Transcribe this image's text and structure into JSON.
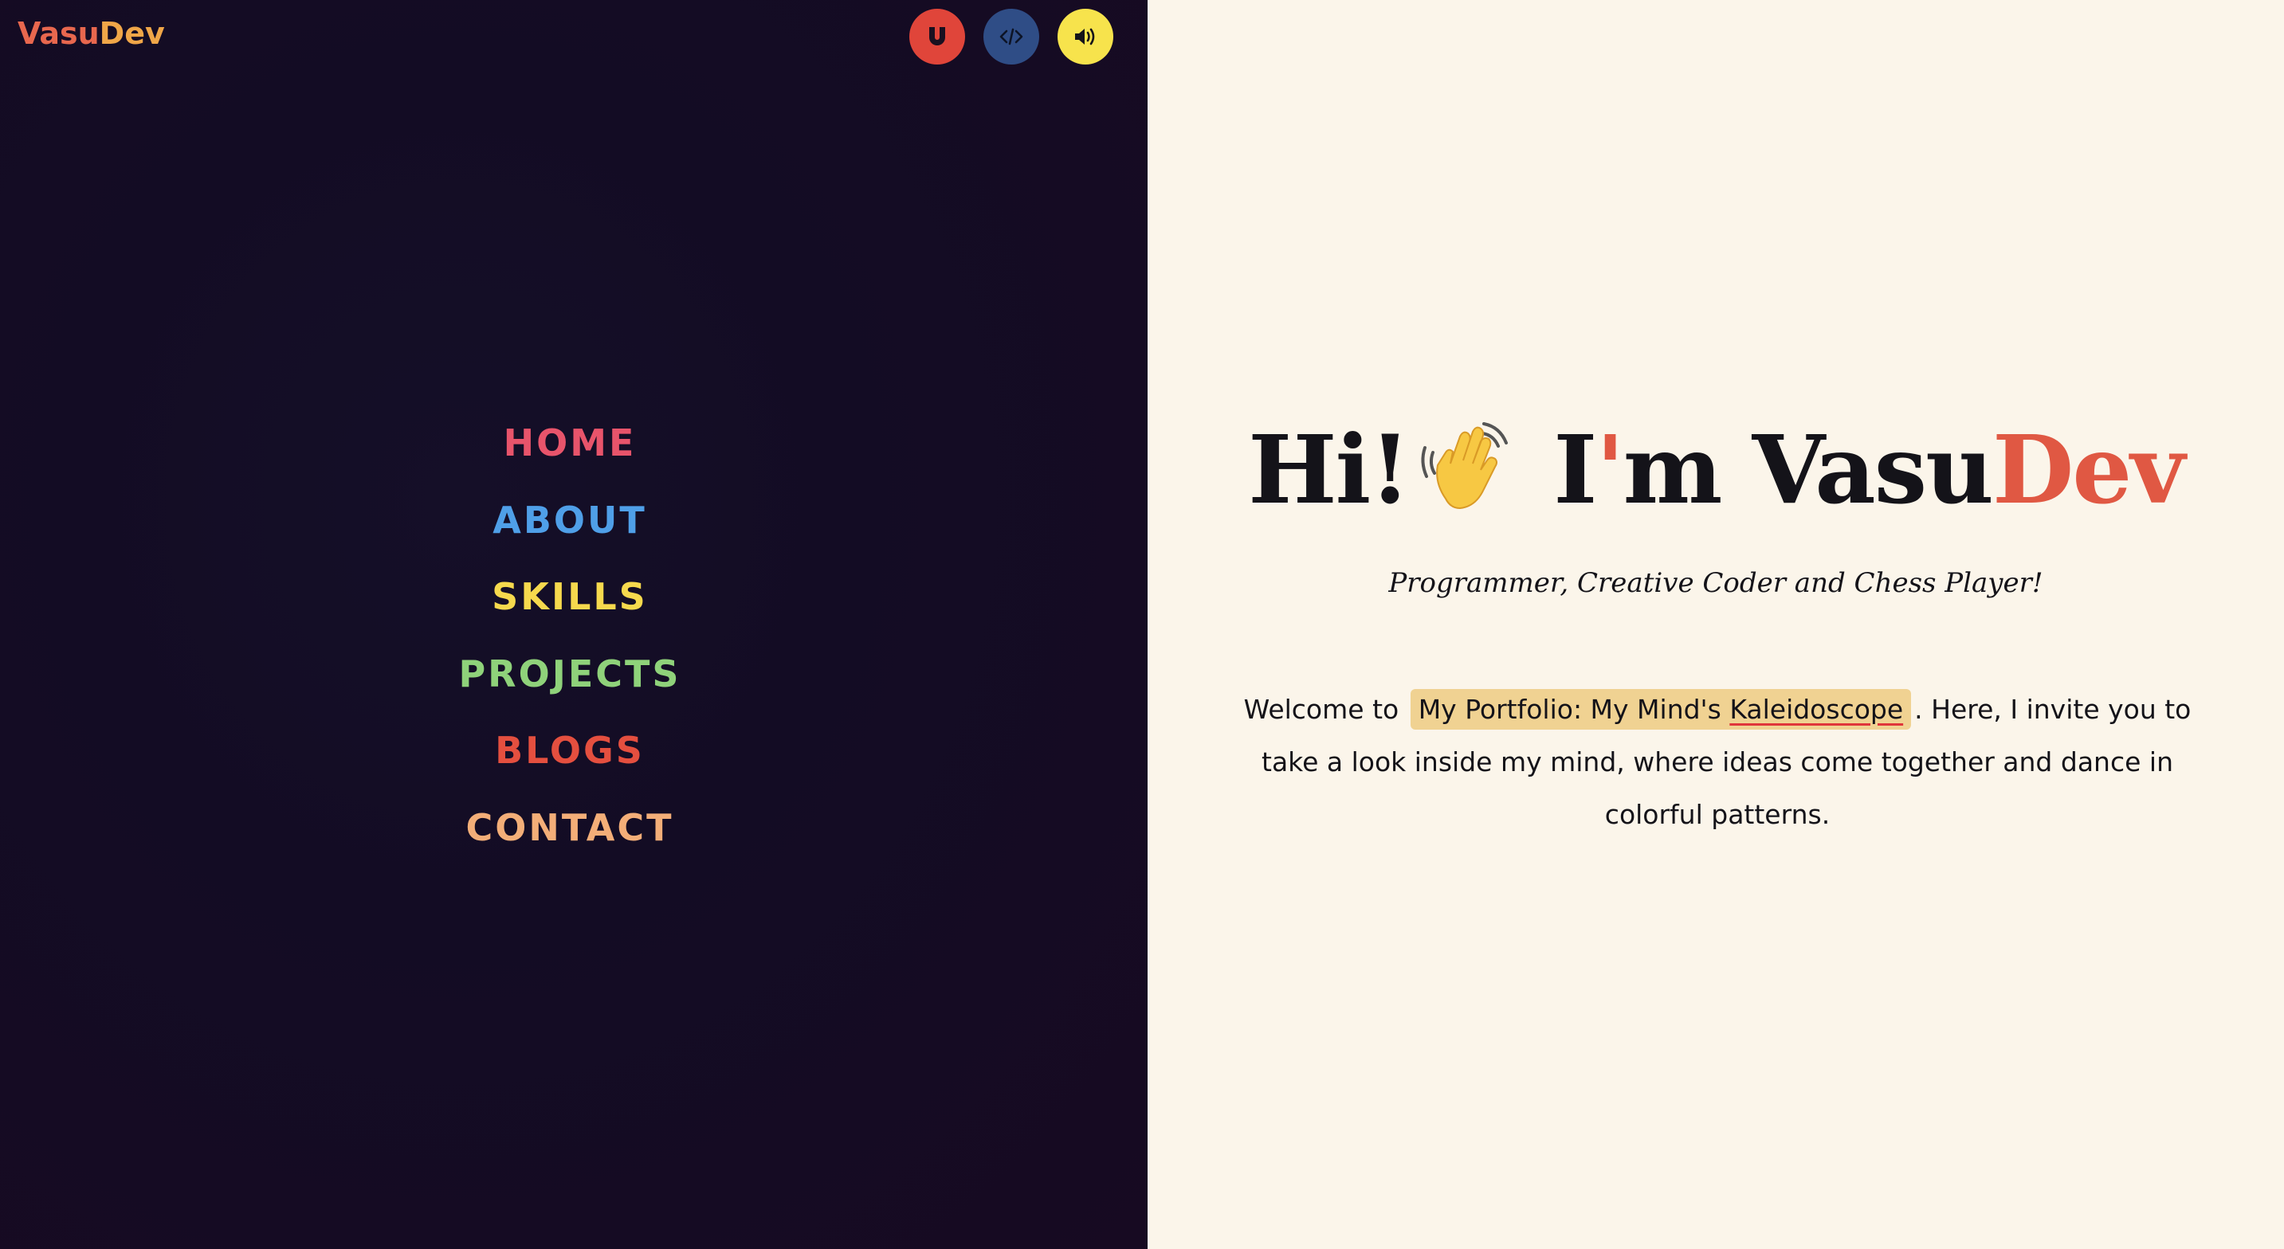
{
  "logo": {
    "part1": "Vasu",
    "part2": "Dev"
  },
  "toolbar": {
    "magnet_icon": "magnet-icon",
    "code_icon": "code-icon",
    "sound_icon": "speaker-icon",
    "colors": {
      "magnet": "#e0453a",
      "code": "#2f4d86",
      "sound": "#f7e34c"
    }
  },
  "nav": {
    "items": [
      {
        "label": "HOME",
        "color": "#e8546b"
      },
      {
        "label": "ABOUT",
        "color": "#4f9fe8"
      },
      {
        "label": "SKILLS",
        "color": "#f6d94d"
      },
      {
        "label": "PROJECTS",
        "color": "#8fd27a"
      },
      {
        "label": "BLOGS",
        "color": "#e44f3f"
      },
      {
        "label": "CONTACT",
        "color": "#f3ae78"
      }
    ]
  },
  "hero": {
    "greeting": "Hi!",
    "wave_icon": "waving-hand-icon",
    "im_prefix": "I",
    "apostrophe": "'",
    "im_suffix": "m ",
    "name_part1": "Vasu",
    "name_part2": "Dev",
    "subtitle": "Programmer, Creative Coder and Chess Player!",
    "intro_before": "Welcome to",
    "intro_highlight_main": "My Portfolio: My Mind's ",
    "intro_highlight_underlined": "Kaleidoscope",
    "intro_after": ". Here, I invite you to take a look inside my mind, where ideas come together and dance in colorful patterns."
  },
  "colors": {
    "left_bg": "#130c24",
    "right_bg": "#fbf5ea",
    "accent": "#e05843",
    "highlight_bg": "#f0d292"
  }
}
